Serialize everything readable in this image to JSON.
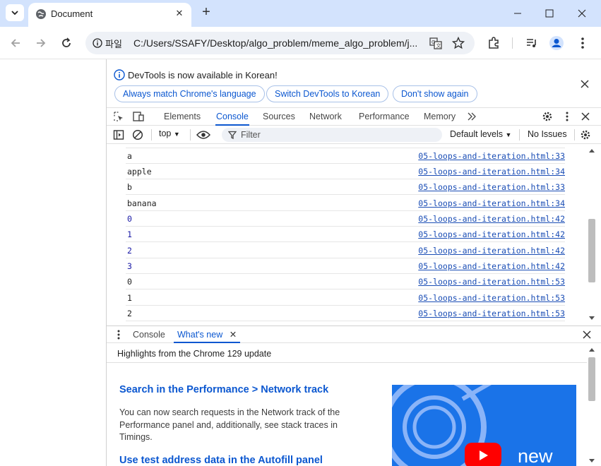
{
  "browser": {
    "tab_title": "Document",
    "url": "C:/Users/SSAFY/Desktop/algo_problem/meme_algo_problem/j...",
    "site_info_label": "파일"
  },
  "devtools": {
    "infobar": {
      "message": "DevTools is now available in Korean!",
      "btn_match": "Always match Chrome's language",
      "btn_switch": "Switch DevTools to Korean",
      "btn_dont_show": "Don't show again"
    },
    "tabs": [
      "Elements",
      "Console",
      "Sources",
      "Network",
      "Performance",
      "Memory"
    ],
    "console_toolbar": {
      "context": "top",
      "filter_placeholder": "Filter",
      "levels": "Default levels",
      "issues": "No Issues"
    },
    "log_rows": [
      {
        "value": "a",
        "source": "05-loops-and-iteration.html:33",
        "kind": "string"
      },
      {
        "value": "apple",
        "source": "05-loops-and-iteration.html:34",
        "kind": "string"
      },
      {
        "value": "b",
        "source": "05-loops-and-iteration.html:33",
        "kind": "string"
      },
      {
        "value": "banana",
        "source": "05-loops-and-iteration.html:34",
        "kind": "string"
      },
      {
        "value": "0",
        "source": "05-loops-and-iteration.html:42",
        "kind": "number"
      },
      {
        "value": "1",
        "source": "05-loops-and-iteration.html:42",
        "kind": "number"
      },
      {
        "value": "2",
        "source": "05-loops-and-iteration.html:42",
        "kind": "number"
      },
      {
        "value": "3",
        "source": "05-loops-and-iteration.html:42",
        "kind": "number"
      },
      {
        "value": "0",
        "source": "05-loops-and-iteration.html:53",
        "kind": "string"
      },
      {
        "value": "1",
        "source": "05-loops-and-iteration.html:53",
        "kind": "string"
      },
      {
        "value": "2",
        "source": "05-loops-and-iteration.html:53",
        "kind": "string"
      }
    ],
    "drawer": {
      "tab_console": "Console",
      "tab_whats_new": "What's new",
      "header": "Highlights from the Chrome 129 update",
      "link1": "Search in the Performance > Network track",
      "body1": "You can now search requests in the Network track of the Performance panel and, additionally, see stack traces in Timings.",
      "link2": "Use test address data in the Autofill panel",
      "image_text": "new"
    }
  },
  "colors": {
    "accent": "#0b57d0",
    "number": "#1a1aa6",
    "link": "#1a4db5",
    "titlebar": "#d3e3fd"
  }
}
